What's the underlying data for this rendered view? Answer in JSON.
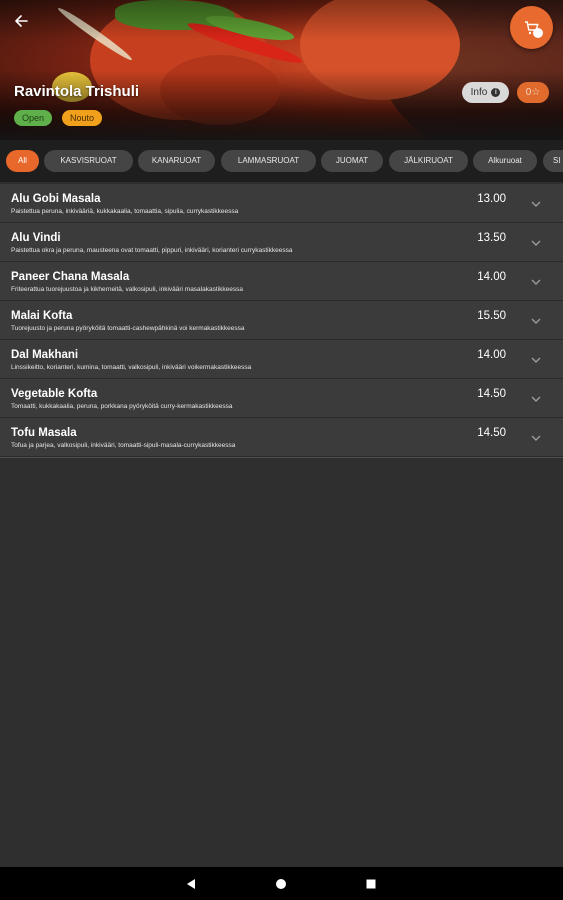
{
  "header": {
    "restaurant_name": "Ravintola Trishuli",
    "tag_open": "Open",
    "tag_pickup": "Nouto",
    "info_label": "Info",
    "rating_label": "0☆",
    "cart_count": ""
  },
  "categories": [
    {
      "label": "All",
      "active": true
    },
    {
      "label": "KASVISRUOAT"
    },
    {
      "label": "KANARUOAT"
    },
    {
      "label": "LAMMASRUOAT"
    },
    {
      "label": "JUOMAT"
    },
    {
      "label": "JÄLKIRUOAT"
    },
    {
      "label": "Alkuruoat"
    },
    {
      "label": "SI"
    }
  ],
  "menu": [
    {
      "name": "Alu Gobi Masala",
      "desc": "Paistettua peruna, inkivääriä, kukkakaalia, tomaattia, sipulia, currykastikkeessa",
      "price": "13.00"
    },
    {
      "name": "Alu Vindi",
      "desc": "Paistettua okra ja peruna, mausteena ovat tomaatti, pippuri, inkivääri, korianteri currykastikkeessa",
      "price": "13.50"
    },
    {
      "name": "Paneer Chana Masala",
      "desc": "Friteerattua tuorejuustoa ja kikherneitä, valkosipuli, inkivääri masalakastikkeessa",
      "price": "14.00"
    },
    {
      "name": "Malai Kofta",
      "desc": "Tuorejuusto ja peruna pyöryköitä tomaatti-cashewpähkinä voi kermakastikkeessa",
      "price": "15.50"
    },
    {
      "name": "Dal Makhani",
      "desc": "Linssikeitto, korianteri, kumina, tomaatti, valkosipuli, inkivääri voikermakastikkeessa",
      "price": "14.00"
    },
    {
      "name": "Vegetable Kofta",
      "desc": "Tomaatti, kukkakaalia, peruna, porkkana pyöryköitä curry-kermakastikkeessa",
      "price": "14.50"
    },
    {
      "name": "Tofu Masala",
      "desc": "Tofua ja parjea, valkosipuli, inkivääri, tomaatti-sipuli-masala-currykastikkeessa",
      "price": "14.50"
    }
  ],
  "icons": {
    "back": "arrow-left-icon",
    "cart": "cart-icon",
    "info": "info-icon",
    "chevron": "chevron-down-icon",
    "nav_back": "triangle-back-icon",
    "nav_home": "circle-home-icon",
    "nav_recent": "square-recents-icon"
  },
  "colors": {
    "accent": "#e8682c",
    "open": "#5fb04a",
    "pickup": "#f0a01a",
    "row_bg": "#3b3b3b",
    "page_bg": "#2f2f2f"
  }
}
